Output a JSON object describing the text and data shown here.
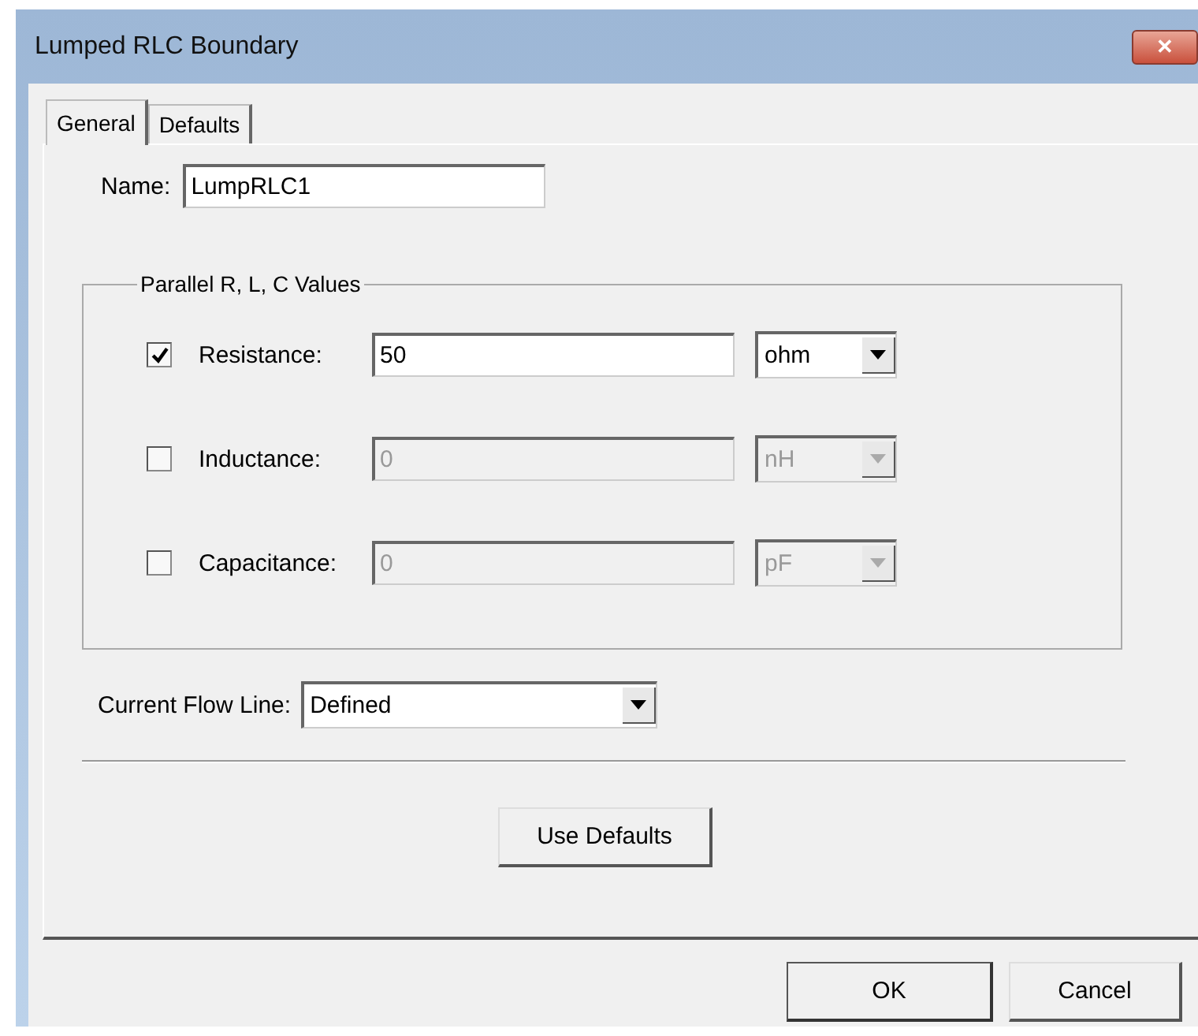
{
  "window": {
    "title": "Lumped RLC Boundary",
    "close": "✕"
  },
  "tabs": [
    {
      "label": "General",
      "selected": true
    },
    {
      "label": "Defaults",
      "selected": false
    }
  ],
  "name_field": {
    "label": "Name:",
    "value": "LumpRLC1"
  },
  "group": {
    "legend": "Parallel R, L, C Values",
    "rows": [
      {
        "label": "Resistance:",
        "checked": true,
        "disabled": false,
        "value": "50",
        "unit": "ohm"
      },
      {
        "label": "Inductance:",
        "checked": false,
        "disabled": true,
        "value": "0",
        "unit": "nH"
      },
      {
        "label": "Capacitance:",
        "checked": false,
        "disabled": true,
        "value": "0",
        "unit": "pF"
      }
    ]
  },
  "current_flow_line": {
    "label": "Current Flow Line:",
    "value": "Defined"
  },
  "use_defaults_button": "Use Defaults",
  "buttons": [
    "OK",
    "Cancel"
  ]
}
